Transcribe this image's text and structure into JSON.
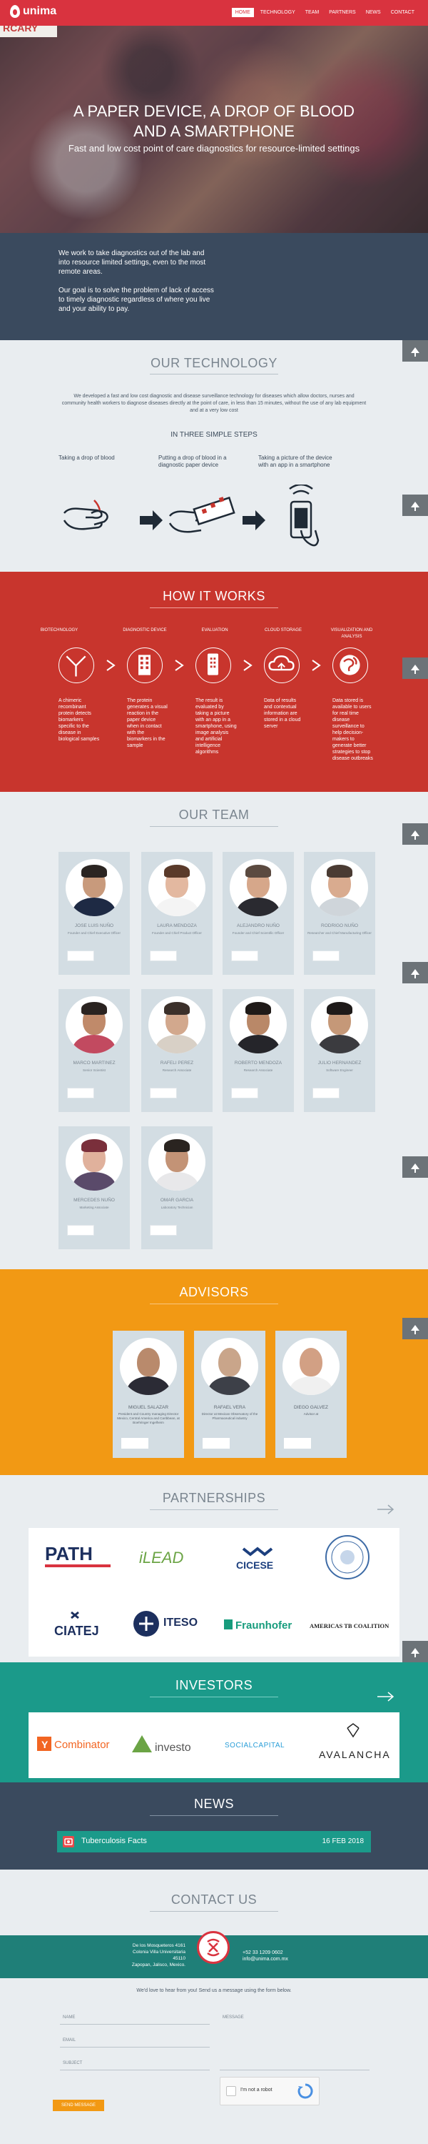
{
  "nav": {
    "brand": "unima",
    "items": [
      {
        "label": "HOME",
        "active": true
      },
      {
        "label": "TECHNOLOGY",
        "active": false
      },
      {
        "label": "TEAM",
        "active": false
      },
      {
        "label": "PARTNERS",
        "active": false
      },
      {
        "label": "NEWS",
        "active": false
      },
      {
        "label": "CONTACT",
        "active": false
      }
    ]
  },
  "hero": {
    "title_line1": "A PAPER DEVICE, A DROP OF BLOOD",
    "title_line2": "AND A SMARTPHONE",
    "subtitle": "Fast and low cost point of care diagnostics for resource-limited settings",
    "banner_text": "RCARY"
  },
  "mission": {
    "p1": "We work to take diagnostics out of the lab and into resource limited settings, even to the most remote areas.",
    "p2": "Our goal is to solve the problem of lack of access to timely diagnostic regardless of where you live and your ability to pay."
  },
  "technology": {
    "title": "OUR TECHNOLOGY",
    "description": "We developed a fast and low cost diagnostic and disease surveillance technology for diseases which allow doctors, nurses and community health workers to diagnose diseases directly at the point of care, in less than 15 minutes, without the use of any lab equipment and at a very low cost",
    "steps_title": "IN THREE SIMPLE STEPS",
    "steps": [
      "Taking a drop of blood",
      "Putting a drop of blood in a diagnostic paper device",
      "Taking a picture of the device with an app in a smartphone"
    ]
  },
  "how": {
    "title": "HOW IT WORKS",
    "steps": [
      {
        "head": "BIOTECHNOLOGY",
        "text": "A chimeric recombinant protein detects biomarkers specific to the disease in biological samples"
      },
      {
        "head": "DIAGNOSTIC DEVICE",
        "text": "The protein generates a visual reaction in the paper device when in contact with the biomarkers in the sample"
      },
      {
        "head": "EVALUATION",
        "text": "The result is evaluated by taking a picture with an app in a smartphone, using image analysis and artificial intelligence algorithms"
      },
      {
        "head": "CLOUD STORAGE",
        "text": "Data of results and contextual information are stored in a cloud server"
      },
      {
        "head": "VISUALIZATION AND ANALYSIS",
        "text": "Data stored is available to users for real time disease surveillance to help decision-makers to generate better strategies to stop disease outbreaks"
      }
    ]
  },
  "team": {
    "title": "OUR TEAM",
    "members": [
      {
        "name": "JOSE LUIS NUÑO",
        "role": "Founder and Chief Executive Officer",
        "skin": "#c89a7c",
        "hair": "#2b2522",
        "shirt": "#1e2a44"
      },
      {
        "name": "LAURA MENDOZA",
        "role": "Founder and Chief Product Officer",
        "skin": "#e3b8a0",
        "hair": "#5a3a2a",
        "shirt": "#f4f4f4"
      },
      {
        "name": "ALEJANDRO NUÑO",
        "role": "Founder and Chief Scientific Officer",
        "skin": "#d6a78a",
        "hair": "#5b4a40",
        "shirt": "#2a2a30"
      },
      {
        "name": "RODRIGO NUÑO",
        "role": "Researcher and Chief Manufacturing Officer",
        "skin": "#d9ab8f",
        "hair": "#4a3b33",
        "shirt": "#cfd5da"
      },
      {
        "name": "MARCO MARTINEZ",
        "role": "Senior Scientist",
        "skin": "#c08a6a",
        "hair": "#2a2320",
        "shirt": "#c24a60"
      },
      {
        "name": "RAFELI PEREZ",
        "role": "Research Associate",
        "skin": "#d2a88d",
        "hair": "#3b302a",
        "shirt": "#d8d0c6"
      },
      {
        "name": "ROBERTO MENDOZA",
        "role": "Research Associate",
        "skin": "#b98868",
        "hair": "#1f1a18",
        "shirt": "#25252a"
      },
      {
        "name": "JULIO HERNANDEZ",
        "role": "Software Engineer",
        "skin": "#c59878",
        "hair": "#1e1a19",
        "shirt": "#3b3b3f"
      },
      {
        "name": "MERCEDES NUÑO",
        "role": "Marketing Associate",
        "skin": "#e0b19c",
        "hair": "#7a2f3b",
        "shirt": "#5a4a6a"
      },
      {
        "name": "OMAR GARCIA",
        "role": "Laboratory Technician",
        "skin": "#c39376",
        "hair": "#2a2420",
        "shirt": "#e8e8ea"
      }
    ]
  },
  "advisors": {
    "title": "ADVISORS",
    "members": [
      {
        "name": "MIGUEL SALAZAR",
        "role": "President and Country managing Director Mexico, Central America and Caribbean, at Boehringer Ingelheim",
        "skin": "#b98a6c",
        "shirt": "#2b2b35"
      },
      {
        "name": "RAFAEL VERA",
        "role": "Director at Mexican Observatory of the Pharmaceutical industry",
        "skin": "#c9a58a",
        "shirt": "#3d4048"
      },
      {
        "name": "DIEGO GALVEZ",
        "role": "Advisor at",
        "skin": "#d2a084",
        "shirt": "#f0f0f0"
      }
    ]
  },
  "partners": {
    "title": "PARTNERSHIPS",
    "logos": [
      "PATH",
      "iLEAD",
      "CICESE",
      "University seal",
      "CIATEJ",
      "ITESO",
      "Fraunhofer",
      "AMERICAS TB COALITION"
    ]
  },
  "investors": {
    "title": "INVESTORS",
    "logos": [
      "Combinator",
      "investo",
      "SOCIALCAPITAL",
      "AVALANCHA"
    ]
  },
  "news": {
    "title": "NEWS",
    "item_title": "Tuberculosis Facts",
    "item_date": "16 FEB 2018"
  },
  "contact": {
    "title": "CONTACT US",
    "address": [
      "De los Mosqueteros 4161",
      "Colonia Villa Universitaria",
      "45110",
      "Zapopan, Jalisco, Mexico."
    ],
    "phone": "+52 33 1209 0602",
    "email": "info@unima.com.mx",
    "intro": "We'd love to hear from you! Send us a message using the form below.",
    "fields": {
      "name": "NAME",
      "email": "EMAIL",
      "subject": "SUBJECT",
      "message": "MESSAGE"
    },
    "captcha": "I'm not a robot",
    "send": "SEND MESSAGE"
  },
  "colors": {
    "nav": "#d9333f",
    "how": "#c8352d",
    "advisors": "#f29914",
    "investors": "#1b9a8a",
    "news": "#3a4a5e"
  }
}
